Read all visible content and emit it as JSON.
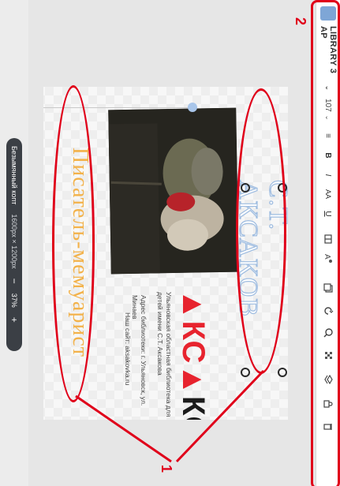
{
  "toolbar": {
    "font_family": "LIBRARY 3 AP",
    "font_size": "107",
    "format_buttons": [
      "≡",
      "B",
      "I",
      "AA",
      "U"
    ],
    "icons": [
      "align-icon",
      "bold-icon",
      "italic-icon",
      "case-icon",
      "underline-icon",
      "text-spacing-icon",
      "effects-icon",
      "duplicate-icon",
      "rotate-icon",
      "zoom-icon",
      "pattern-icon",
      "layers-icon",
      "lock-icon",
      "delete-icon"
    ]
  },
  "annotations": {
    "num1": "1",
    "num2": "2"
  },
  "canvas": {
    "title": "С.Т. АКСАКОВ",
    "logo_parts": [
      "▲КС",
      "▲",
      "КОВ"
    ],
    "library_name": "Ульяновская областная библиотека для детей имени С.Т. Аксакова",
    "address": "Адрес библиотеки: г. Ульяновск, ул. Минаев",
    "site": "Наш сайт: aksakovka.ru",
    "subtitle": "Писатель-мемуарист"
  },
  "document": {
    "name": "Безымянный копт",
    "size": "1600px × 1200px",
    "zoom": "37%",
    "minus": "−",
    "plus": "+"
  },
  "colors": {
    "annotation": "#e0001a",
    "title_stroke": "#9ebce0",
    "subtitle": "#f3b24a",
    "logo_accent": "#e7232e"
  }
}
